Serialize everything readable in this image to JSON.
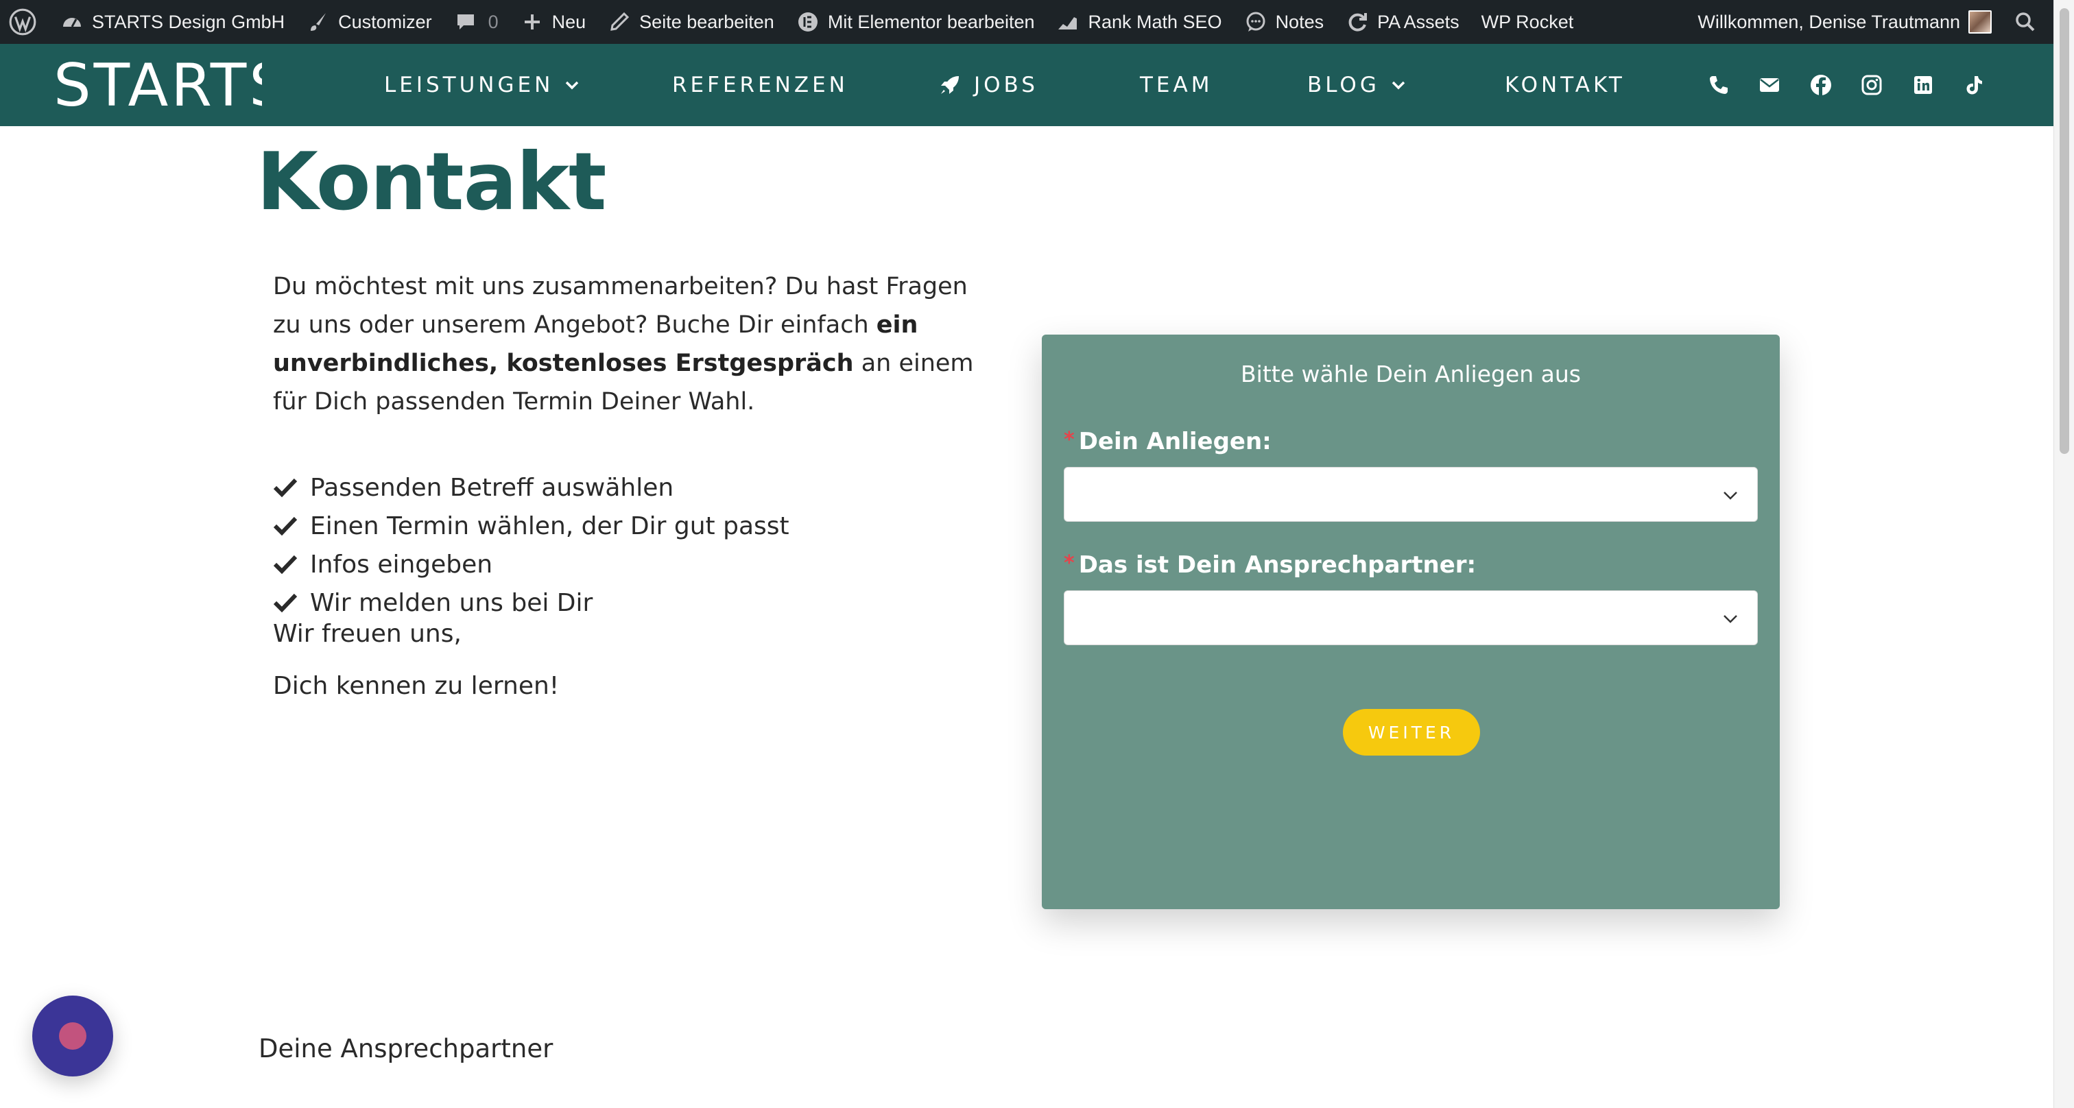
{
  "adminbar": {
    "site_name": "STARTS Design GmbH",
    "customizer": "Customizer",
    "comments_count": "0",
    "new": "Neu",
    "edit_page": "Seite bearbeiten",
    "elementor": "Mit Elementor bearbeiten",
    "rankmath": "Rank Math SEO",
    "notes": "Notes",
    "pa_assets": "PA Assets",
    "wp_rocket": "WP Rocket",
    "welcome": "Willkommen, Denise Trautmann"
  },
  "header": {
    "logo_text": "STARTS",
    "nav": [
      {
        "label": "LEISTUNGEN"
      },
      {
        "label": "REFERENZEN"
      },
      {
        "label": "JOBS"
      },
      {
        "label": "TEAM"
      },
      {
        "label": "BLOG"
      },
      {
        "label": "KONTAKT"
      }
    ],
    "social_icons": [
      "phone-icon",
      "mail-icon",
      "facebook-icon",
      "instagram-icon",
      "linkedin-icon",
      "tiktok-icon"
    ]
  },
  "content": {
    "title": "Kontakt",
    "intro_part1": "Du möchtest mit uns zusammenarbeiten? Du hast Fragen zu uns oder unserem Angebot? Buche Dir einfach ",
    "intro_bold": "ein unverbindliches, kostenloses Erstgespräch",
    "intro_part2": "  an einem für Dich passenden Termin Deiner Wahl.",
    "checklist": [
      "Passenden Betreff auswählen",
      "Einen Termin wählen, der Dir gut passt",
      "Infos eingeben",
      "Wir melden uns bei Dir"
    ],
    "closing1": "Wir freuen uns,",
    "closing2": "Dich kennen zu lernen!",
    "contact_heading": "Deine Ansprechpartner"
  },
  "form": {
    "heading": "Bitte wähle Dein Anliegen aus",
    "field1_label": "Dein Anliegen:",
    "field1_value": "",
    "field2_label": "Das ist Dein Ansprechpartner:",
    "field2_value": "",
    "submit": "WEITER"
  },
  "colors": {
    "header_bg": "#1e5b58",
    "form_bg": "#6a9488",
    "button": "#f6c90e",
    "chat_widget": "#3b3597"
  }
}
